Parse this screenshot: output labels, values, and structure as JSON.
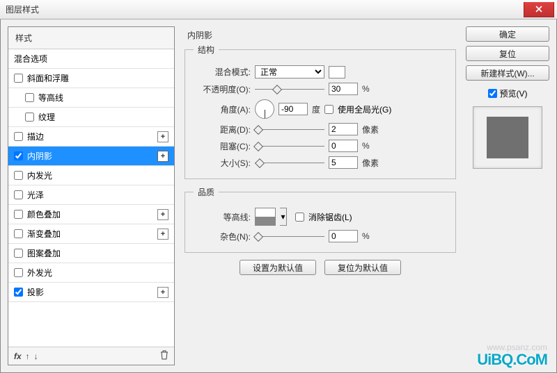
{
  "window": {
    "title": "图层样式"
  },
  "styles": {
    "header": "样式",
    "blend": "混合选项",
    "bevel": "斜面和浮雕",
    "contour": "等高线",
    "texture": "纹理",
    "stroke": "描边",
    "innerShadow": "内阴影",
    "innerGlow": "内发光",
    "satin": "光泽",
    "colorOverlay": "颜色叠加",
    "gradOverlay": "渐变叠加",
    "patOverlay": "图案叠加",
    "outerGlow": "外发光",
    "dropShadow": "投影",
    "fx": "fx"
  },
  "panel": {
    "title": "内阴影",
    "structure": "结构",
    "quality": "品质",
    "blendMode": "混合模式:",
    "blendModeValue": "正常",
    "opacity": "不透明度(O):",
    "opacityValue": "30",
    "angle": "角度(A):",
    "angleValue": "-90",
    "degree": "度",
    "globalLight": "使用全局光(G)",
    "distance": "距离(D):",
    "distanceValue": "2",
    "px": "像素",
    "choke": "阻塞(C):",
    "chokeValue": "0",
    "size": "大小(S):",
    "sizeValue": "5",
    "contour": "等高线:",
    "antiAlias": "消除锯齿(L)",
    "noise": "杂色(N):",
    "noiseValue": "0",
    "percent": "%",
    "setDefault": "设置为默认值",
    "resetDefault": "复位为默认值"
  },
  "buttons": {
    "ok": "确定",
    "cancel": "复位",
    "newStyle": "新建样式(W)...",
    "preview": "预览(V)"
  },
  "watermark": {
    "a": "www.psanz.com",
    "b": "UiBQ.CoM"
  }
}
